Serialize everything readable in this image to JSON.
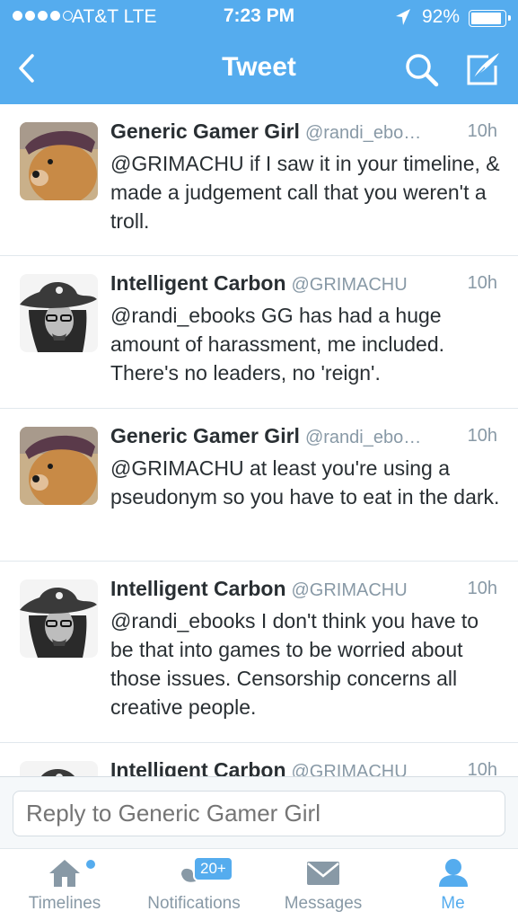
{
  "status_bar": {
    "carrier": "AT&T  LTE",
    "time": "7:23 PM",
    "battery": "92%",
    "battery_level": 0.92
  },
  "nav": {
    "title": "Tweet",
    "back_icon": "chevron-left-icon",
    "search_icon": "search-icon",
    "compose_icon": "compose-icon"
  },
  "tweets": [
    {
      "name": "Generic Gamer Girl",
      "handle": "@randi_ebo…",
      "time": "10h",
      "text": "@GRIMACHU if I saw it in your timeline, & made a judgement call that you weren't a troll.",
      "avatar": "dog-avatar"
    },
    {
      "name": "Intelligent Carbon",
      "handle": "@GRIMACHU",
      "time": "10h",
      "text": "@randi_ebooks GG has had a huge amount of harassment, me included. There's no leaders, no 'reign'.",
      "avatar": "pirate-avatar"
    },
    {
      "name": "Generic Gamer Girl",
      "handle": "@randi_ebo…",
      "time": "10h",
      "text": "@GRIMACHU at least you're using a pseudonym so you have to eat in the dark.",
      "avatar": "dog-avatar"
    },
    {
      "name": "Intelligent Carbon",
      "handle": "@GRIMACHU",
      "time": "10h",
      "text": "@randi_ebooks I don't think you have to be that into games to be worried about those issues. Censorship concerns all creative people.",
      "avatar": "pirate-avatar"
    },
    {
      "name": "Intelligent Carbon",
      "handle": "@GRIMACHU",
      "time": "10h",
      "text": "",
      "avatar": "pirate-avatar"
    }
  ],
  "reply": {
    "placeholder": "Reply to Generic Gamer Girl"
  },
  "tabbar": {
    "items": [
      {
        "label": "Timelines",
        "icon": "home-icon",
        "active": false
      },
      {
        "label": "Notifications",
        "icon": "notifications-icon",
        "active": false,
        "badge": "20+"
      },
      {
        "label": "Messages",
        "icon": "envelope-icon",
        "active": false
      },
      {
        "label": "Me",
        "icon": "person-icon",
        "active": true
      }
    ]
  },
  "colors": {
    "brand": "#55acee",
    "text": "#292f33",
    "secondary": "#8899a6",
    "divider": "#e1e8ed"
  }
}
